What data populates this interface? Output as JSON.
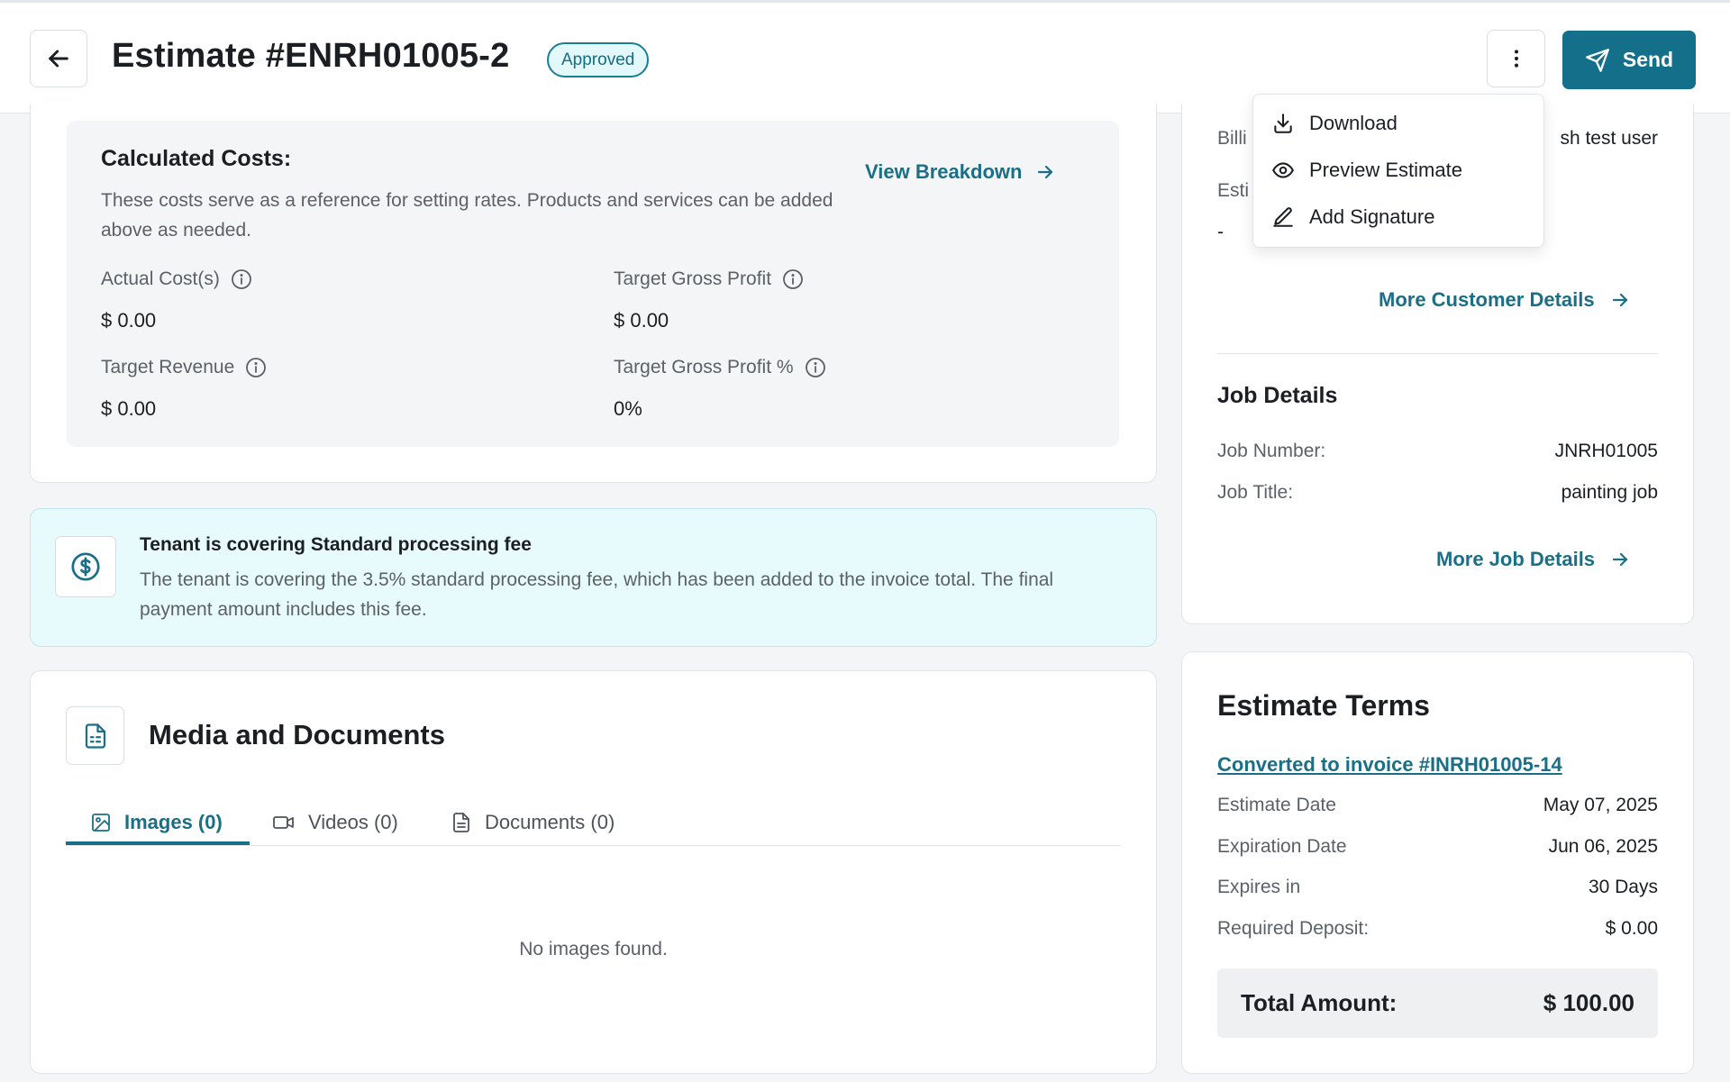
{
  "header": {
    "title": "Estimate #ENRH01005-2",
    "status": "Approved",
    "send_label": "Send"
  },
  "dropdown_menu": {
    "items": [
      {
        "label": "Download",
        "icon": "download-icon"
      },
      {
        "label": "Preview Estimate",
        "icon": "eye-icon"
      },
      {
        "label": "Add Signature",
        "icon": "pen-icon"
      }
    ]
  },
  "calculated_costs": {
    "title": "Calculated Costs:",
    "description": "These costs serve as a reference for setting rates. Products and services can be added above as needed.",
    "view_breakdown": "View Breakdown",
    "metrics": [
      {
        "label": "Actual Cost(s)",
        "value": "$ 0.00"
      },
      {
        "label": "Target Gross Profit",
        "value": "$ 0.00"
      },
      {
        "label": "Target Revenue",
        "value": "$ 0.00"
      },
      {
        "label": "Target Gross Profit %",
        "value": "0%"
      }
    ]
  },
  "fee_banner": {
    "title": "Tenant is covering Standard processing fee",
    "description": "The tenant is covering the 3.5% standard processing fee, which has been added to the invoice total. The final payment amount includes this fee."
  },
  "media": {
    "title": "Media and Documents",
    "tabs": [
      {
        "label": "Images (0)",
        "icon": "image-icon"
      },
      {
        "label": "Videos (0)",
        "icon": "video-icon"
      },
      {
        "label": "Documents (0)",
        "icon": "document-icon"
      }
    ],
    "empty_text": "No images found."
  },
  "customer": {
    "billing_label_partial": "Billi",
    "billing_value_partial": "sh test user",
    "estimate_label_partial": "Esti",
    "estimate_value": "-",
    "more_link": "More Customer Details"
  },
  "job_details": {
    "title": "Job Details",
    "rows": [
      {
        "label": "Job Number:",
        "value": "JNRH01005"
      },
      {
        "label": "Job Title:",
        "value": "painting job"
      }
    ],
    "more_link": "More Job Details"
  },
  "estimate_terms": {
    "title": "Estimate Terms",
    "converted_link": "Converted to invoice #INRH01005-14",
    "rows": [
      {
        "label": "Estimate Date",
        "value": "May 07, 2025"
      },
      {
        "label": "Expiration Date",
        "value": "Jun 06, 2025"
      },
      {
        "label": "Expires in",
        "value": "30 Days"
      },
      {
        "label": "Required Deposit:",
        "value": "$ 0.00"
      }
    ],
    "total_label": "Total Amount:",
    "total_value": "$ 100.00"
  },
  "colors": {
    "accent": "#136f8a",
    "badge_bg": "#e2f8fb",
    "banner_bg": "#e8fbfc"
  }
}
